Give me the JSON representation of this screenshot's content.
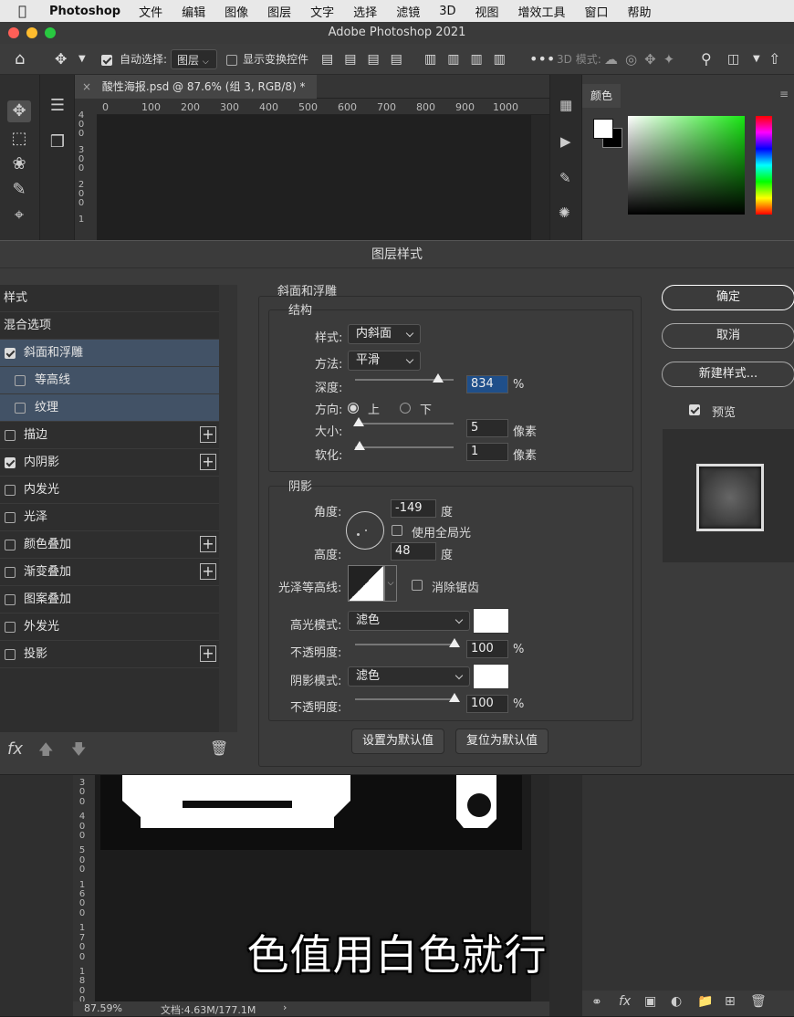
{
  "menubar": {
    "app_name": "Photoshop",
    "items": [
      "文件",
      "编辑",
      "图像",
      "图层",
      "文字",
      "选择",
      "滤镜",
      "3D",
      "视图",
      "增效工具",
      "窗口",
      "帮助"
    ]
  },
  "window": {
    "title": "Adobe Photoshop 2021"
  },
  "options_bar": {
    "auto_select_label": "自动选择:",
    "auto_select_target": "图层",
    "show_transform_label": "显示变换控件",
    "mode_3d_label": "3D 模式:"
  },
  "document": {
    "tab_title": "酸性海报.psd @ 87.6% (组 3, RGB/8) *",
    "ruler_h": [
      "0",
      "100",
      "200",
      "300",
      "400",
      "500",
      "600",
      "700",
      "800",
      "900",
      "1000"
    ],
    "ruler_v_top": [
      "4",
      "0",
      "0",
      "3",
      "0",
      "0",
      "2",
      "0",
      "0",
      "1"
    ],
    "ruler_v_bottom": [
      "3",
      "0",
      "0",
      "4",
      "0",
      "0",
      "5",
      "0",
      "0",
      "1",
      "6",
      "0",
      "0",
      "1",
      "7",
      "0",
      "0",
      "1",
      "8",
      "0",
      "0"
    ],
    "zoom": "87.59%",
    "doc_size": "文档:4.63M/177.1M"
  },
  "color_panel": {
    "tab_label": "颜色"
  },
  "dialog": {
    "title": "图层样式",
    "styles_header": "样式",
    "blend_options": "混合选项",
    "style_items": [
      {
        "label": "斜面和浮雕",
        "checked": true,
        "plus": false
      },
      {
        "label": "等高线",
        "checked": false,
        "plus": false
      },
      {
        "label": "纹理",
        "checked": false,
        "plus": false
      },
      {
        "label": "描边",
        "checked": false,
        "plus": true
      },
      {
        "label": "内阴影",
        "checked": true,
        "plus": true
      },
      {
        "label": "内发光",
        "checked": false,
        "plus": false
      },
      {
        "label": "光泽",
        "checked": false,
        "plus": false
      },
      {
        "label": "颜色叠加",
        "checked": false,
        "plus": true
      },
      {
        "label": "渐变叠加",
        "checked": false,
        "plus": true
      },
      {
        "label": "图案叠加",
        "checked": false,
        "plus": false
      },
      {
        "label": "外发光",
        "checked": false,
        "plus": false
      },
      {
        "label": "投影",
        "checked": false,
        "plus": true
      }
    ],
    "fx_label": "fx",
    "section_title": "斜面和浮雕",
    "structure": {
      "heading": "结构",
      "style_label": "样式:",
      "style_value": "内斜面",
      "technique_label": "方法:",
      "technique_value": "平滑",
      "depth_label": "深度:",
      "depth_value": "834",
      "depth_unit": "%",
      "direction_label": "方向:",
      "direction_up": "上",
      "direction_down": "下",
      "size_label": "大小:",
      "size_value": "5",
      "size_unit": "像素",
      "soften_label": "软化:",
      "soften_value": "1",
      "soften_unit": "像素"
    },
    "shading": {
      "heading": "阴影",
      "angle_label": "角度:",
      "angle_value": "-149",
      "angle_unit": "度",
      "global_light_label": "使用全局光",
      "altitude_label": "高度:",
      "altitude_value": "48",
      "altitude_unit": "度",
      "gloss_contour_label": "光泽等高线:",
      "antialias_label": "消除锯齿",
      "highlight_mode_label": "高光模式:",
      "highlight_mode_value": "滤色",
      "highlight_opacity_label": "不透明度:",
      "highlight_opacity_value": "100",
      "highlight_opacity_unit": "%",
      "shadow_mode_label": "阴影模式:",
      "shadow_mode_value": "滤色",
      "shadow_opacity_label": "不透明度:",
      "shadow_opacity_value": "100",
      "shadow_opacity_unit": "%",
      "highlight_color": "#ffffff",
      "shadow_color": "#ffffff"
    },
    "make_default": "设置为默认值",
    "reset_default": "复位为默认值",
    "ok": "确定",
    "cancel": "取消",
    "new_style": "新建样式...",
    "preview_label": "预览"
  },
  "subtitle": "色值用白色就行"
}
